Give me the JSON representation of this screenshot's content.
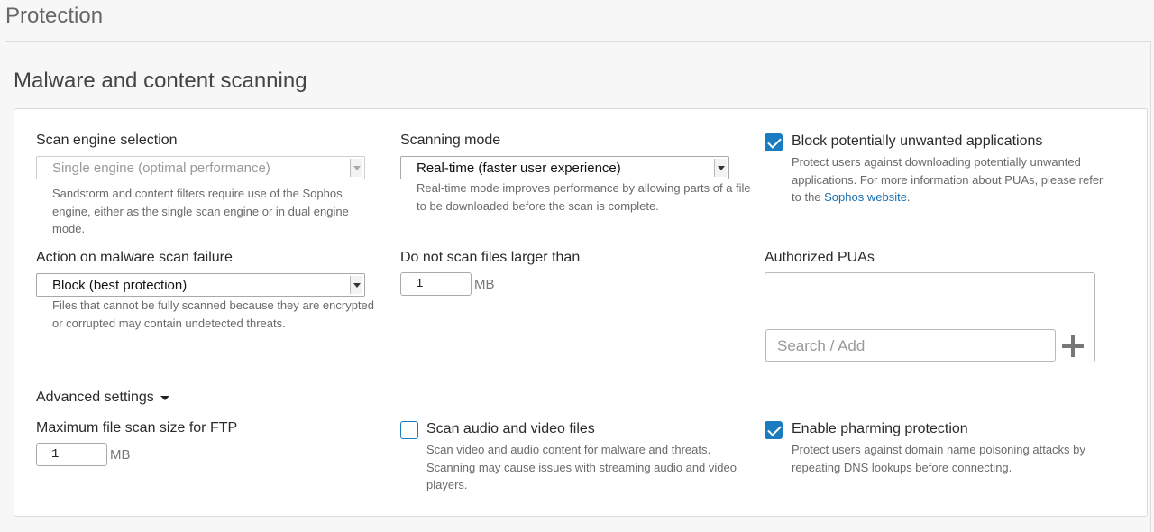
{
  "page": {
    "title": "Protection"
  },
  "section": {
    "title": "Malware and content scanning"
  },
  "scan_engine": {
    "label": "Scan engine selection",
    "value": "Single engine (optimal performance)",
    "help": "Sandstorm and content filters require use of the Sophos engine, either as the single scan engine or in dual engine mode."
  },
  "scanning_mode": {
    "label": "Scanning mode",
    "value": "Real-time (faster user experience)",
    "help": "Real-time mode improves performance by allowing parts of a file to be downloaded before the scan is complete."
  },
  "block_pua": {
    "label": "Block potentially unwanted applications",
    "checked": true,
    "help_prefix": "Protect users against downloading potentially unwanted applications. For more information about PUAs, please refer to the ",
    "link": "Sophos website",
    "help_suffix": "."
  },
  "action_failure": {
    "label": "Action on malware scan failure",
    "value": "Block (best protection)",
    "help": "Files that cannot be fully scanned because they are encrypted or corrupted may contain undetected threats."
  },
  "max_size": {
    "label": "Do not scan files larger than",
    "value": "1",
    "unit": "MB"
  },
  "authorized_puas": {
    "label": "Authorized PUAs",
    "placeholder": "Search / Add"
  },
  "advanced": {
    "label": "Advanced settings"
  },
  "ftp": {
    "label": "Maximum file scan size for FTP",
    "value": "1",
    "unit": "MB"
  },
  "audio_video": {
    "label": "Scan audio and video files",
    "checked": false,
    "help": "Scan video and audio content for malware and threats. Scanning may cause issues with streaming audio and video players."
  },
  "pharming": {
    "label": "Enable pharming protection",
    "checked": true,
    "help": "Protect users against domain name poisoning attacks by repeating DNS lookups before connecting."
  },
  "colors": {
    "accent": "#1a7bbf",
    "link": "#1a6fb0"
  }
}
